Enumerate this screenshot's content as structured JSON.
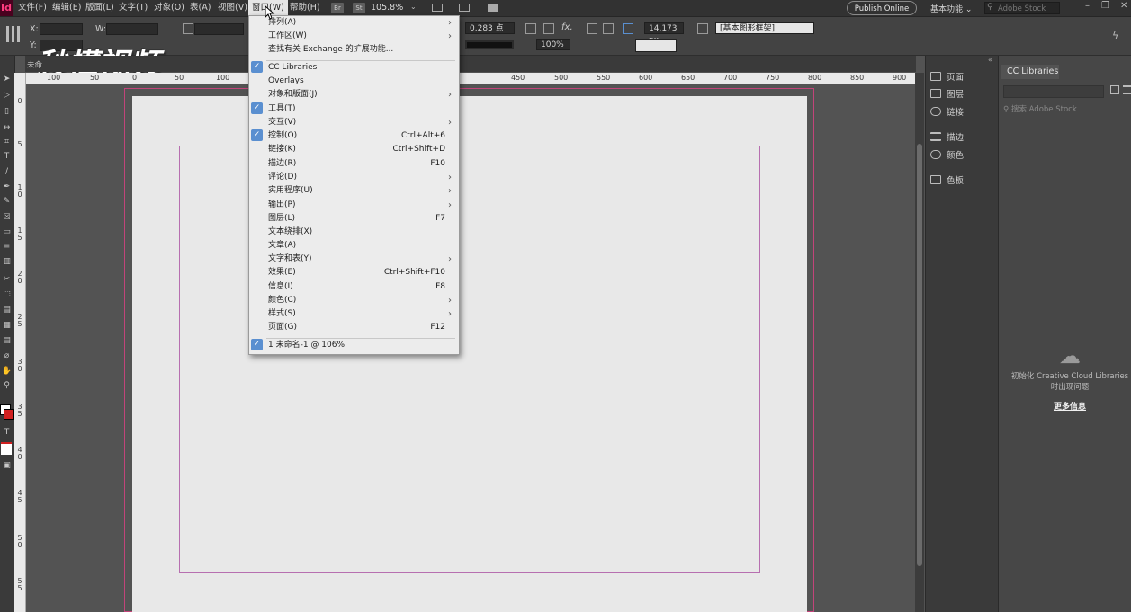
{
  "app": {
    "logo": "Id"
  },
  "menubar": {
    "items": [
      "文件(F)",
      "编辑(E)",
      "版面(L)",
      "文字(T)",
      "对象(O)",
      "表(A)",
      "视图(V)",
      "窗口(W)",
      "帮助(H)"
    ],
    "bridge": "Br",
    "stock": "St",
    "zoom": "105.8%",
    "publish": "Publish Online",
    "workspace": "基本功能",
    "search_placeholder": "Adobe Stock"
  },
  "control": {
    "x_label": "X:",
    "y_label": "Y:",
    "w_label": "W:",
    "stroke_weight": "0.283 点",
    "opacity": "100%",
    "size_value": "14.173 px",
    "frame_style": "[基本图形框架]"
  },
  "watermark": "秒懂视频",
  "document_tab": "未命",
  "ruler_top": [
    "100",
    "50",
    "0",
    "50",
    "100",
    "450",
    "500",
    "550",
    "600",
    "650",
    "700",
    "750",
    "800",
    "850",
    "900"
  ],
  "ruler_left": [
    "0",
    "5",
    "1 0",
    "1 5",
    "2 0",
    "2 5",
    "3 0",
    "3 5",
    "4 0",
    "4 5",
    "5 0",
    "5 5"
  ],
  "window_menu": {
    "items": [
      {
        "label": "排列(A)",
        "shortcut": "",
        "submenu": true,
        "checked": false
      },
      {
        "label": "工作区(W)",
        "shortcut": "",
        "submenu": true,
        "checked": false
      },
      {
        "label": "查找有关 Exchange 的扩展功能...",
        "shortcut": "",
        "submenu": false,
        "checked": false
      },
      {
        "label": "CC Libraries",
        "shortcut": "",
        "submenu": false,
        "checked": true
      },
      {
        "label": "Overlays",
        "shortcut": "",
        "submenu": false,
        "checked": false
      },
      {
        "label": "对象和版面(J)",
        "shortcut": "",
        "submenu": true,
        "checked": false
      },
      {
        "label": "工具(T)",
        "shortcut": "",
        "submenu": false,
        "checked": true
      },
      {
        "label": "交互(V)",
        "shortcut": "",
        "submenu": true,
        "checked": false
      },
      {
        "label": "控制(O)",
        "shortcut": "Ctrl+Alt+6",
        "submenu": false,
        "checked": true
      },
      {
        "label": "链接(K)",
        "shortcut": "Ctrl+Shift+D",
        "submenu": false,
        "checked": false
      },
      {
        "label": "描边(R)",
        "shortcut": "F10",
        "submenu": false,
        "checked": false
      },
      {
        "label": "评论(D)",
        "shortcut": "",
        "submenu": true,
        "checked": false
      },
      {
        "label": "实用程序(U)",
        "shortcut": "",
        "submenu": true,
        "checked": false
      },
      {
        "label": "输出(P)",
        "shortcut": "",
        "submenu": true,
        "checked": false
      },
      {
        "label": "图层(L)",
        "shortcut": "F7",
        "submenu": false,
        "checked": false
      },
      {
        "label": "文本绕排(X)",
        "shortcut": "",
        "submenu": false,
        "checked": false
      },
      {
        "label": "文章(A)",
        "shortcut": "",
        "submenu": false,
        "checked": false
      },
      {
        "label": "文字和表(Y)",
        "shortcut": "",
        "submenu": true,
        "checked": false
      },
      {
        "label": "效果(E)",
        "shortcut": "Ctrl+Shift+F10",
        "submenu": false,
        "checked": false
      },
      {
        "label": "信息(I)",
        "shortcut": "F8",
        "submenu": false,
        "checked": false
      },
      {
        "label": "颜色(C)",
        "shortcut": "",
        "submenu": true,
        "checked": false
      },
      {
        "label": "样式(S)",
        "shortcut": "",
        "submenu": true,
        "checked": false
      },
      {
        "label": "页面(G)",
        "shortcut": "F12",
        "submenu": false,
        "checked": false
      },
      {
        "label": "1 未命名-1 @ 106%",
        "shortcut": "",
        "submenu": false,
        "checked": true
      }
    ]
  },
  "dock": {
    "items": [
      "页面",
      "图层",
      "链接",
      "描边",
      "颜色",
      "色板"
    ]
  },
  "cc_libraries": {
    "tab": "CC Libraries",
    "search_placeholder": "搜索 Adobe Stock",
    "message": "初始化 Creative Cloud Libraries 时出现问题",
    "more_info": "更多信息"
  },
  "colors": {
    "accent": "#5a8fd0",
    "bleed_guide": "#c2447a",
    "margin_guide": "#b76fb0"
  }
}
